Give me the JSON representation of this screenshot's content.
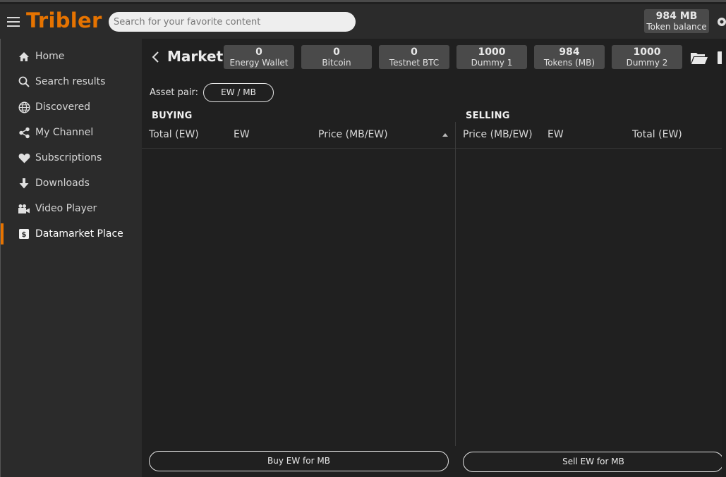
{
  "app": {
    "name": "Tribler"
  },
  "search": {
    "placeholder": "Search for your favorite content"
  },
  "token_balance": {
    "amount": "984 MB",
    "label": "Token balance"
  },
  "sidebar": {
    "items": [
      {
        "label": "Home",
        "icon": "home-icon"
      },
      {
        "label": "Search results",
        "icon": "search-icon"
      },
      {
        "label": "Discovered",
        "icon": "globe-icon"
      },
      {
        "label": "My Channel",
        "icon": "share-icon"
      },
      {
        "label": "Subscriptions",
        "icon": "heart-icon"
      },
      {
        "label": "Downloads",
        "icon": "download-arrow-icon"
      },
      {
        "label": "Video Player",
        "icon": "video-camera-icon"
      },
      {
        "label": "Datamarket Place",
        "icon": "market-icon",
        "active": true
      }
    ]
  },
  "market": {
    "title": "Market",
    "wallets": [
      {
        "amount": "0",
        "label": "Energy Wallet"
      },
      {
        "amount": "0",
        "label": "Bitcoin"
      },
      {
        "amount": "0",
        "label": "Testnet BTC"
      },
      {
        "amount": "1000",
        "label": "Dummy 1"
      },
      {
        "amount": "984",
        "label": "Tokens (MB)"
      },
      {
        "amount": "1000",
        "label": "Dummy 2"
      }
    ],
    "asset_pair_label": "Asset pair:",
    "asset_pair_value": "EW / MB",
    "buying": {
      "heading": "BUYING",
      "columns": [
        "Total (EW)",
        "EW",
        "Price (MB/EW)"
      ],
      "button": "Buy EW for MB"
    },
    "selling": {
      "heading": "SELLING",
      "columns": [
        "Price (MB/EW)",
        "EW",
        "Total (EW)"
      ],
      "button": "Sell EW for MB"
    }
  },
  "colors": {
    "accent": "#e67300",
    "background": "#202020",
    "sidebar": "#2b2b2b",
    "badge": "#4a4a4a"
  }
}
